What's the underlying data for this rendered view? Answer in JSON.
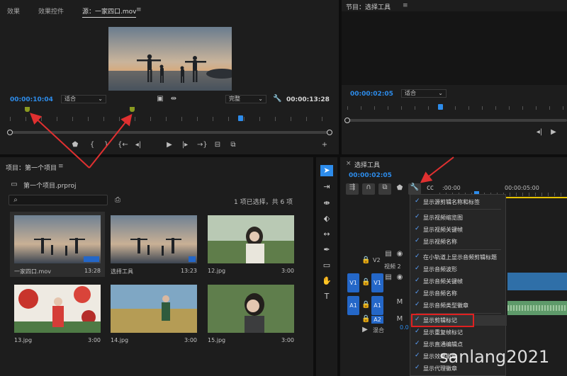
{
  "source_monitor": {
    "tabs": [
      "效果",
      "效果控件",
      "源：一家四口.mov"
    ],
    "menu_icon": "≡",
    "current_timecode": "00:00:10:04",
    "fit_label": "适合",
    "quality_label": "完整",
    "duration": "00:00:13:28"
  },
  "program_monitor": {
    "title": "节目：选择工具",
    "menu_icon": "≡",
    "timecode": "00:00:02:05",
    "fit_label": "适合"
  },
  "project": {
    "title": "项目：第一个项目",
    "menu_icon": "≡",
    "file": "第一个项目.prproj",
    "status": "1 项已选择，共 6 项",
    "items": [
      {
        "name": "一家四口.mov",
        "duration": "13:28"
      },
      {
        "name": "选择工具",
        "duration": "13:23"
      },
      {
        "name": "12.jpg",
        "duration": "3:00"
      },
      {
        "name": "13.jpg",
        "duration": "3:00"
      },
      {
        "name": "14.jpg",
        "duration": "3:00"
      },
      {
        "name": "15.jpg",
        "duration": "3:00"
      }
    ]
  },
  "timeline": {
    "title": "选择工具",
    "timecode": "00:00:02:05",
    "ruler": [
      ":00:00",
      "00:00:05:00"
    ],
    "tracks": {
      "v2": "V2",
      "v1_src": "V1",
      "v1": "V1",
      "a1_src": "A1",
      "a1": "A1",
      "a2": "A2",
      "mix": "混合",
      "mix_value": "0.0",
      "video_name": "视频 2"
    }
  },
  "context_menu": {
    "items": [
      {
        "label": "显示源剪辑名称和标签",
        "checked": true
      },
      {
        "label": "显示视频缩览图",
        "checked": true
      },
      {
        "label": "显示视频关键帧",
        "checked": true
      },
      {
        "label": "显示视频名称",
        "checked": true
      },
      {
        "label": "在小轨道上显示音频剪辑标题",
        "checked": true
      },
      {
        "label": "显示音频波形",
        "checked": true
      },
      {
        "label": "显示音频关键帧",
        "checked": true
      },
      {
        "label": "显示音频名称",
        "checked": true
      },
      {
        "label": "显示音频类型徽章",
        "checked": true
      },
      {
        "label": "显示剪辑标记",
        "checked": true
      },
      {
        "label": "显示重复帧标记",
        "checked": true
      },
      {
        "label": "显示直通编辑点",
        "checked": true
      },
      {
        "label": "显示效果徽章",
        "checked": true
      },
      {
        "label": "显示代理徽章",
        "checked": true
      }
    ]
  },
  "watermark": "sanlang2021",
  "colors": {
    "accent": "#2d8ceb",
    "highlight": "#e02020",
    "arrow": "#e03030",
    "marker": "#8a9a20"
  }
}
